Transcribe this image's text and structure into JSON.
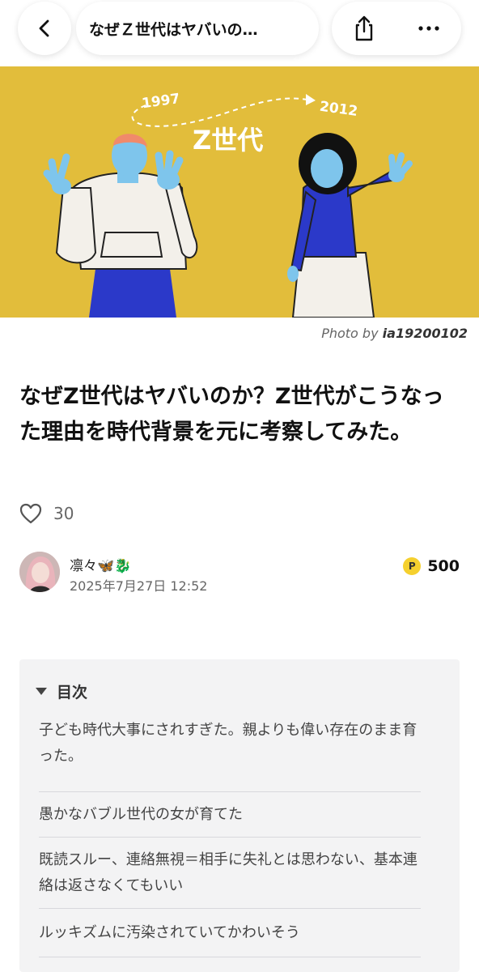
{
  "header": {
    "title": "なぜＺ世代はヤバいの…",
    "back_icon": "chevron-left-icon",
    "share_icon": "share-icon",
    "more_icon": "more-horizontal-icon"
  },
  "hero": {
    "year_start": "1997",
    "year_end": "2012",
    "heading": "Z世代",
    "background_color": "#e2bd3b",
    "accent_blue": "#2b39c9",
    "skin_blue": "#7ec5ec",
    "caption_prefix": "Photo by",
    "caption_author": "ia19200102"
  },
  "article": {
    "title": "なぜZ世代はヤバいのか？Z世代がこうなった理由を時代背景を元に考察してみた。",
    "like_count": "30"
  },
  "author": {
    "name": "凛々🦋🐉",
    "date": "2025年7月27日 12:52",
    "points": "500",
    "points_badge": "P"
  },
  "toc": {
    "label": "目次",
    "items": [
      "子ども時代大事にされすぎた。親よりも偉い存在のまま育った。",
      "愚かなバブル世代の女が育てた",
      "既読スルー、連絡無視＝相手に失礼とは思わない、基本連絡は返さなくてもいい",
      "ルッキズムに汚染されていてかわいそう"
    ]
  }
}
